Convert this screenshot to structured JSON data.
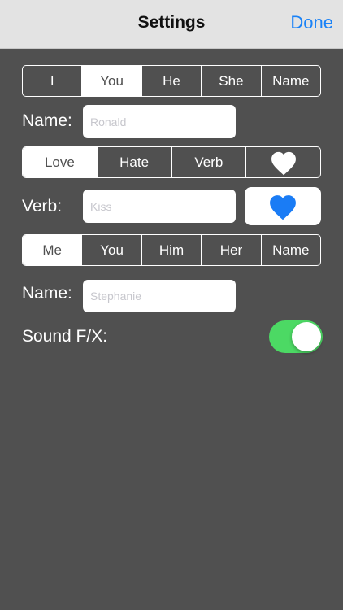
{
  "nav": {
    "title": "Settings",
    "done": "Done"
  },
  "subject_segment": {
    "items": [
      "I",
      "You",
      "He",
      "She",
      "Name"
    ],
    "selected_index": 1
  },
  "subject_name": {
    "label": "Name:",
    "placeholder": "Ronald"
  },
  "action_segment": {
    "items": [
      "Love",
      "Hate",
      "Verb"
    ],
    "heart_icon": "heart-icon",
    "selected_index": 0
  },
  "verb": {
    "label": "Verb:",
    "placeholder": "Kiss",
    "heart_icon": "heart-icon",
    "heart_color": "#1a7cf5"
  },
  "object_segment": {
    "items": [
      "Me",
      "You",
      "Him",
      "Her",
      "Name"
    ],
    "selected_index": 0
  },
  "object_name": {
    "label": "Name:",
    "placeholder": "Stephanie"
  },
  "sound": {
    "label": "Sound F/X:",
    "on": true,
    "on_color": "#4cd964"
  },
  "colors": {
    "background": "#505050",
    "accent": "#1a82f7"
  }
}
